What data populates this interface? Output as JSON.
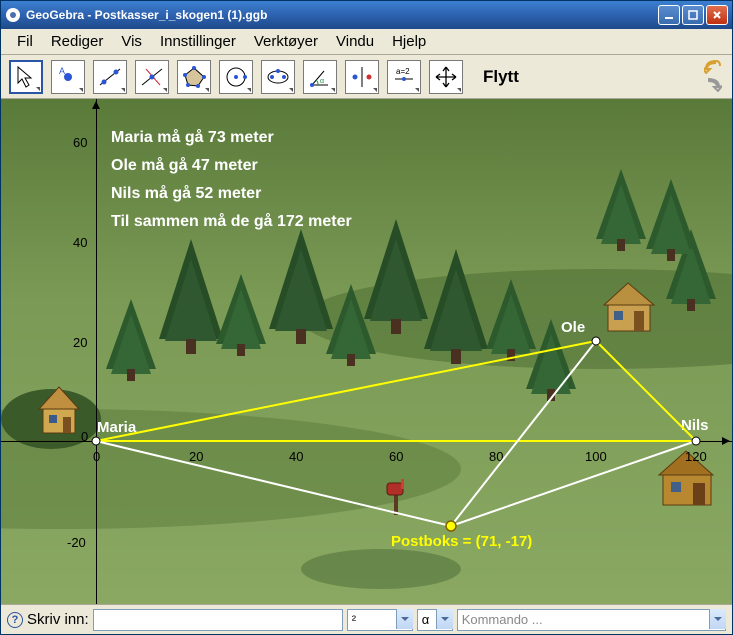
{
  "window": {
    "title": "GeoGebra - Postkasser_i_skogen1 (1).ggb"
  },
  "menu": {
    "fil": "Fil",
    "rediger": "Rediger",
    "vis": "Vis",
    "innstillinger": "Innstillinger",
    "verktoyer": "Verktøyer",
    "vindu": "Vindu",
    "hjelp": "Hjelp"
  },
  "toolbar": {
    "current_tool": "Flytt"
  },
  "overlay": {
    "l1": "Maria må gå 73 meter",
    "l2": "Ole må gå 47 meter",
    "l3": "Nils må gå 52 meter",
    "l4": "Til sammen må de gå 172 meter"
  },
  "points": {
    "maria": {
      "label": "Maria",
      "x": 0,
      "y": 0
    },
    "ole": {
      "label": "Ole",
      "x": 100,
      "y": 20
    },
    "nils": {
      "label": "Nils",
      "x": 120,
      "y": 0
    },
    "postboks": {
      "label": "Postboks = (71, -17)",
      "x": 71,
      "y": -17
    }
  },
  "axes": {
    "x_ticks": [
      "0",
      "20",
      "40",
      "60",
      "80",
      "100",
      "120"
    ],
    "y_ticks": [
      "-20",
      "0",
      "20",
      "40",
      "60"
    ]
  },
  "bottombar": {
    "label": "Skriv inn:",
    "sym": "²",
    "greek": "α",
    "cmd_placeholder": "Kommando ..."
  },
  "chart_data": {
    "type": "scatter",
    "title": "Postkasser i skogen",
    "xlabel": "",
    "ylabel": "",
    "xlim": [
      -15,
      130
    ],
    "ylim": [
      -30,
      70
    ],
    "series": [
      {
        "name": "Maria",
        "x": 0,
        "y": 0
      },
      {
        "name": "Ole",
        "x": 100,
        "y": 20
      },
      {
        "name": "Nils",
        "x": 120,
        "y": 0
      },
      {
        "name": "Postboks",
        "x": 71,
        "y": -17
      }
    ],
    "segments": [
      {
        "from": "Maria",
        "to": "Ole",
        "color": "#ffff00"
      },
      {
        "from": "Maria",
        "to": "Nils",
        "color": "#ffff00"
      },
      {
        "from": "Ole",
        "to": "Nils",
        "color": "#ffff00"
      },
      {
        "from": "Maria",
        "to": "Postboks",
        "color": "#ffffff"
      },
      {
        "from": "Ole",
        "to": "Postboks",
        "color": "#ffffff"
      },
      {
        "from": "Nils",
        "to": "Postboks",
        "color": "#ffffff"
      }
    ],
    "annotations": [
      "Maria må gå 73 meter",
      "Ole må gå 47 meter",
      "Nils må gå 52 meter",
      "Til sammen må de gå 172 meter"
    ]
  }
}
